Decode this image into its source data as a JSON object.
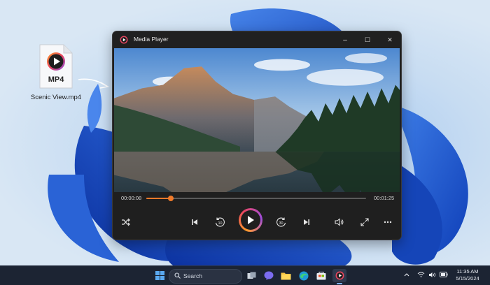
{
  "desktop": {
    "file": {
      "label": "Scenic View.mp4",
      "badge": "MP4",
      "icon": "mp4-file-icon"
    }
  },
  "window": {
    "title": "Media Player",
    "buttons": {
      "minimize": "–",
      "maximize": "☐",
      "close": "✕"
    }
  },
  "player": {
    "elapsed": "00:00:08",
    "duration": "00:01:25",
    "progress_fraction": 0.11,
    "controls": [
      "shuffle-icon",
      "previous-icon",
      "rewind-10-icon",
      "play-icon",
      "forward-30-icon",
      "next-icon",
      "volume-icon",
      "fullscreen-icon",
      "more-icon"
    ],
    "rewind_label": "10",
    "forward_label": "30",
    "accent": "#f07a2a"
  },
  "taskbar": {
    "search_placeholder": "Search",
    "time": "11:35 AM",
    "date": "5/15/2024"
  }
}
